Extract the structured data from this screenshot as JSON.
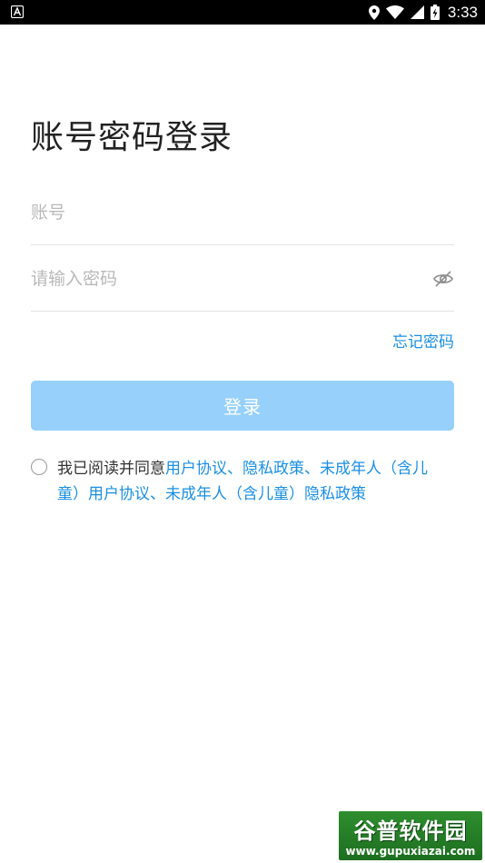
{
  "status_bar": {
    "time": "3:33",
    "left_icon": "app-notification-icon",
    "icons": [
      "location-icon",
      "wifi-icon",
      "signal-icon",
      "battery-charging-icon"
    ]
  },
  "page": {
    "title": "账号密码登录"
  },
  "account": {
    "placeholder": "账号",
    "value": ""
  },
  "password": {
    "placeholder": "请输入密码",
    "value": "",
    "toggle_icon": "eye-hidden-icon"
  },
  "forgot_password": {
    "label": "忘记密码"
  },
  "login": {
    "label": "登录",
    "color": "#96d0fb"
  },
  "agreement": {
    "checked": false,
    "prefix": "我已阅读并同意",
    "user_agreement": "用户协议",
    "sep1": "、",
    "privacy_policy": "隐私政策",
    "sep2": "、",
    "minor_user_agreement": "未成年人（含儿童）用户协议",
    "sep3": "、",
    "minor_privacy_policy": "未成年人（含儿童）隐私政策"
  },
  "watermark": {
    "logo": "谷普软件园",
    "url": "www.gupuxiazai.com"
  },
  "colors": {
    "accent": "#1a8fe3",
    "button_disabled": "#96d0fb",
    "status_bar": "#000000"
  }
}
